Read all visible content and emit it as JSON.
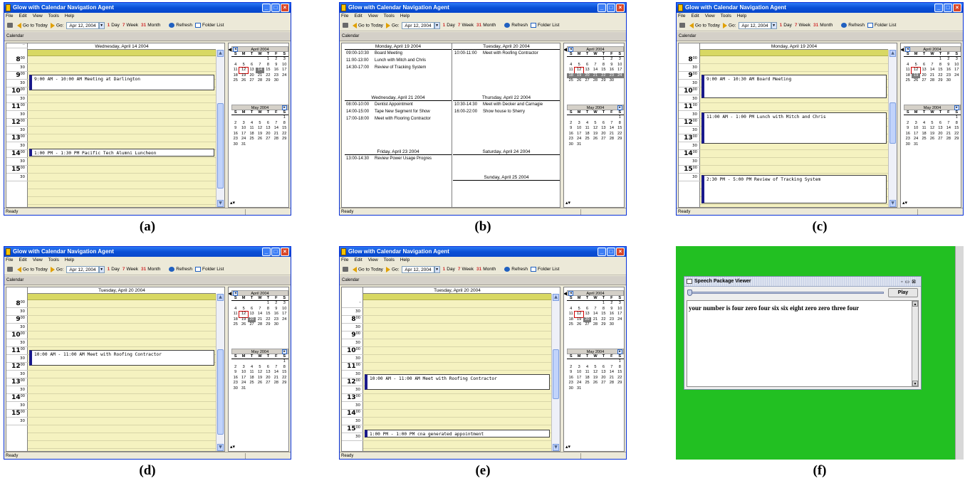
{
  "app": {
    "title": "Glow with Calendar Navigation Agent",
    "menu": [
      "File",
      "Edit",
      "View",
      "Tools",
      "Help"
    ],
    "toolbar": {
      "go_to_today": "Go to Today",
      "go": "Go:",
      "date": "Apr 12, 2004",
      "day": "Day",
      "week": "Week",
      "month": "Month",
      "refresh": "Refresh",
      "folder_list": "Folder List",
      "day_icon_glyph": "1",
      "week_icon_glyph": "7",
      "month_icon_glyph": "31"
    },
    "calendar_label": "Calendar",
    "status": "Ready"
  },
  "mini_april": {
    "title": "April 2004",
    "dow": [
      "S",
      "M",
      "T",
      "W",
      "T",
      "F",
      "S"
    ],
    "days": [
      "",
      "",
      "",
      "",
      "1",
      "2",
      "3",
      "4",
      "5",
      "6",
      "7",
      "8",
      "9",
      "10",
      "11",
      "12",
      "13",
      "14",
      "15",
      "16",
      "17",
      "18",
      "19",
      "20",
      "21",
      "22",
      "23",
      "24",
      "25",
      "26",
      "27",
      "28",
      "29",
      "30"
    ]
  },
  "mini_may": {
    "title": "May 2004",
    "dow": [
      "S",
      "M",
      "T",
      "W",
      "T",
      "F",
      "S"
    ],
    "days": [
      "",
      "",
      "",
      "",
      "",
      "",
      "1",
      "2",
      "3",
      "4",
      "5",
      "6",
      "7",
      "8",
      "9",
      "10",
      "11",
      "12",
      "13",
      "14",
      "15",
      "16",
      "17",
      "18",
      "19",
      "20",
      "21",
      "22",
      "23",
      "24",
      "25",
      "26",
      "27",
      "28",
      "29",
      "30",
      "31"
    ]
  },
  "panels": {
    "a": {
      "caption": "(a)",
      "header": "Wednesday, April 14 2004",
      "hours": [
        "8",
        "9",
        "10",
        "11",
        "12",
        "13",
        "14",
        "15"
      ],
      "half": "30",
      "minutes": "00",
      "top_label": "..",
      "events": [
        "9:00 AM - 10:00 AM Meeting at Darlington",
        "1:00 PM - 1:30 PM Pacific Tech Alumni Luncheon"
      ]
    },
    "b": {
      "caption": "(b)",
      "days": [
        {
          "header": "Monday, April 19 2004",
          "events": [
            [
              "09:00-10:30",
              "Board Meeting"
            ],
            [
              "11:00-13:00",
              "Lunch with Mitch and Chris"
            ],
            [
              "14:30-17:00",
              "Review of Tracking System"
            ]
          ]
        },
        {
          "header": "Tuesday, April 20 2004",
          "events": [
            [
              "10:00-11:00",
              "Meet with Roofing Contractor"
            ]
          ]
        },
        {
          "header": "Wednesday, April 21 2004",
          "events": [
            [
              "08:00-10:00",
              "Dentist Appointment"
            ],
            [
              "14:00-15:00",
              "Tape New Segment for Show"
            ],
            [
              "17:00-18:00",
              "Meet with Flooring Contractor"
            ]
          ]
        },
        {
          "header": "Thursday, April 22 2004",
          "events": [
            [
              "10:30-14:30",
              "Meet with Decker and Carnagie"
            ],
            [
              "16:00-22:00",
              "Show house to Sherry"
            ]
          ]
        },
        {
          "header": "Friday, April 23 2004",
          "events": [
            [
              "13:00-14:30",
              "Review Power Usage Progres"
            ]
          ]
        },
        {
          "header": "Saturday, April 24 2004",
          "events": []
        },
        {
          "header": "Sunday, April 25 2004",
          "events": []
        }
      ]
    },
    "c": {
      "caption": "(c)",
      "header": "Monday, April 19 2004",
      "hours": [
        "8",
        "9",
        "10",
        "11",
        "12",
        "13",
        "14",
        "15"
      ],
      "events": [
        "9:00 AM - 10:30 AM Board Meeting",
        "11:00 AM - 1:00 PM Lunch with Mitch and Chris",
        "2:30 PM - 5:00 PM Review of Tracking System"
      ]
    },
    "d": {
      "caption": "(d)",
      "header": "Tuesday, April 20 2004",
      "hours": [
        "8",
        "9",
        "10",
        "11",
        "12",
        "13",
        "14",
        "15"
      ],
      "events": [
        "10:00 AM - 11:00 AM Meet with Roofing Contractor"
      ]
    },
    "e": {
      "caption": "(e)",
      "header": "Tuesday, April 20 2004",
      "hours": [
        "8",
        "9",
        "10",
        "11",
        "12",
        "13",
        "14",
        "15"
      ],
      "top_label": "'",
      "events": [
        "10:00 AM - 11:00 AM Meet with Roofing Contractor",
        "1:00 PM - 1:00 PM cna generated appointment"
      ]
    },
    "f": {
      "caption": "(f)",
      "title": "Speech Package Viewer",
      "play": "Play",
      "text": "your number is four zero four six six eight zero zero three four",
      "colors": {
        "background": "#22c022"
      }
    }
  }
}
